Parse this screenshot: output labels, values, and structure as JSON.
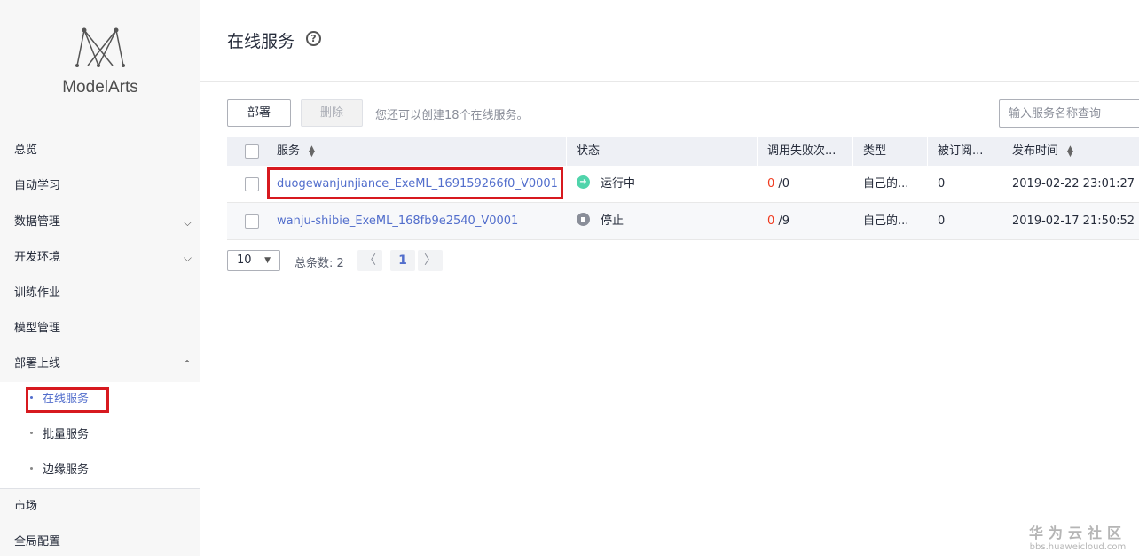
{
  "app": {
    "name": "ModelArts"
  },
  "sidebar": {
    "items": [
      {
        "label": "总览"
      },
      {
        "label": "自动学习"
      },
      {
        "label": "数据管理"
      },
      {
        "label": "开发环境"
      },
      {
        "label": "训练作业"
      },
      {
        "label": "模型管理"
      },
      {
        "label": "部署上线"
      },
      {
        "label": "市场"
      },
      {
        "label": "全局配置"
      }
    ],
    "sub_items": [
      {
        "label": "在线服务"
      },
      {
        "label": "批量服务"
      },
      {
        "label": "边缘服务"
      }
    ]
  },
  "header": {
    "title": "在线服务",
    "help": "?"
  },
  "toolbar": {
    "deploy_label": "部署",
    "delete_label": "删除",
    "hint": "您还可以创建18个在线服务。",
    "search_placeholder": "输入服务名称查询"
  },
  "table": {
    "columns": [
      "服务",
      "状态",
      "调用失败次...",
      "类型",
      "被订阅...",
      "发布时间"
    ],
    "rows": [
      {
        "name": "duogewanjunjiance_ExeML_169159266f0_V0001",
        "status": "运行中",
        "fail": "0",
        "total": "/0",
        "type": "自己的...",
        "subs": "0",
        "time": "2019-02-22 23:01:27"
      },
      {
        "name": "wanju-shibie_ExeML_168fb9e2540_V0001",
        "status": "停止",
        "fail": "0",
        "total": "/9",
        "type": "自己的...",
        "subs": "0",
        "time": "2019-02-17 21:50:52"
      }
    ]
  },
  "pagination": {
    "page_size": "10",
    "total_label": "总条数: 2",
    "current_page": "1",
    "prev": "〈",
    "next": "〉"
  },
  "watermark": {
    "title": "华为云社区",
    "url": "bbs.huaweicloud.com"
  },
  "colors": {
    "accent": "#526ecc",
    "highlight": "#d7191f",
    "fail": "#f03a1e",
    "running": "#50d4ab"
  }
}
